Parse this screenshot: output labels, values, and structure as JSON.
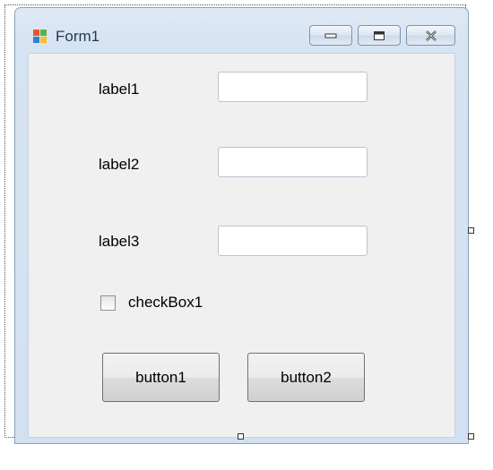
{
  "window": {
    "title": "Form1",
    "icon": "windows-form-icon",
    "controls": {
      "minimize": "minimize-icon",
      "maximize": "maximize-icon",
      "close": "close-icon"
    }
  },
  "form": {
    "label1": "label1",
    "label2": "label2",
    "label3": "label3",
    "textbox1_value": "",
    "textbox2_value": "",
    "textbox3_value": "",
    "checkbox_label": "checkBox1",
    "checkbox_checked": false,
    "button1_label": "button1",
    "button2_label": "button2"
  },
  "colors": {
    "window_frame": "#d3e0f1",
    "client_background": "#f0f0f0",
    "title_text": "#1e395b"
  }
}
